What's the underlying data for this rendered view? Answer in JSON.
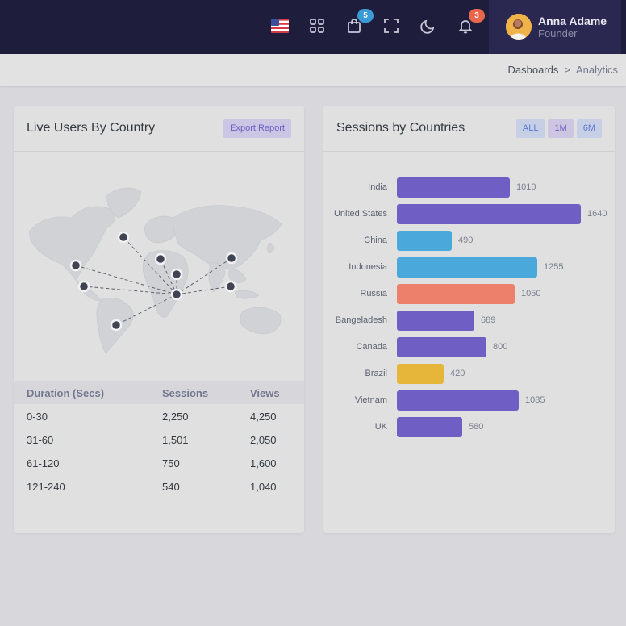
{
  "header": {
    "cart_badge": "5",
    "notif_badge": "3",
    "user": {
      "name": "Anna Adame",
      "role": "Founder"
    },
    "icons": [
      "us-flag-icon",
      "apps-grid-icon",
      "shopping-bag-icon",
      "fullscreen-icon",
      "moon-icon",
      "bell-icon"
    ]
  },
  "breadcrumb": {
    "parent": "Dasboards",
    "separator": ">",
    "current": "Analytics"
  },
  "live_users": {
    "title": "Live Users By Country",
    "export_label": "Export Report",
    "table": {
      "headers": [
        "Duration (Secs)",
        "Sessions",
        "Views"
      ],
      "rows": [
        [
          "0-30",
          "2,250",
          "4,250"
        ],
        [
          "31-60",
          "1,501",
          "2,050"
        ],
        [
          "61-120",
          "750",
          "1,600"
        ],
        [
          "121-240",
          "540",
          "1,040"
        ]
      ]
    }
  },
  "sessions": {
    "title": "Sessions by Countries",
    "filters": [
      "ALL",
      "1M",
      "6M"
    ]
  },
  "chart_data": {
    "type": "bar",
    "orientation": "horizontal",
    "title": "Sessions by Countries",
    "categories": [
      "India",
      "United States",
      "China",
      "Indonesia",
      "Russia",
      "Bangeladesh",
      "Canada",
      "Brazil",
      "Vietnam",
      "UK"
    ],
    "values": [
      1010,
      1640,
      490,
      1255,
      1050,
      689,
      800,
      420,
      1085,
      580
    ],
    "colors": [
      "#6f5fc5",
      "#6f5fc5",
      "#4aa8db",
      "#4aa8db",
      "#ec806a",
      "#6f5fc5",
      "#6f5fc5",
      "#e6b63a",
      "#6f5fc5",
      "#6f5fc5"
    ],
    "xlim": [
      0,
      1640
    ],
    "grid": false
  },
  "colors": {
    "topbar": "#1f1d3c",
    "primary": "#6f5fc5",
    "info": "#4aa8db",
    "danger": "#ec806a",
    "warning": "#e6b63a"
  }
}
